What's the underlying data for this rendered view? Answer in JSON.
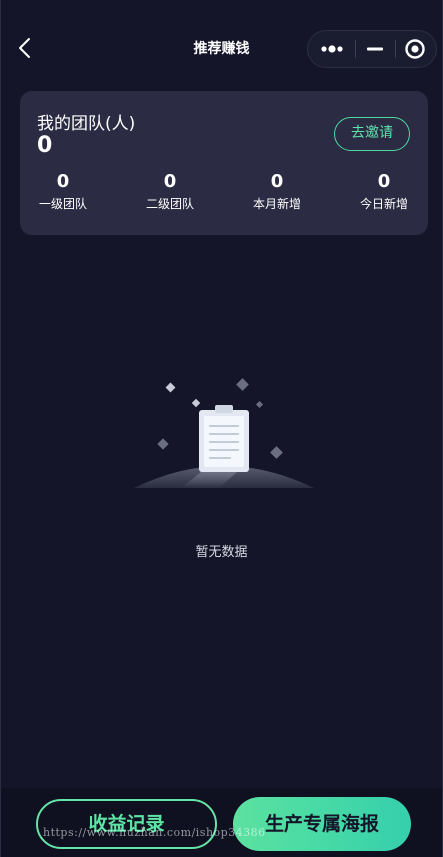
{
  "nav": {
    "title": "推荐赚钱",
    "back_icon": "chevron-left-icon",
    "capsule_icons": [
      "more-dots-icon",
      "minimize-icon",
      "close-target-icon"
    ]
  },
  "team": {
    "title": "我的团队(人)",
    "total": "0",
    "invite_label": "去邀请",
    "stats": [
      {
        "value": "0",
        "label": "一级团队"
      },
      {
        "value": "0",
        "label": "二级团队"
      },
      {
        "value": "0",
        "label": "本月新增"
      },
      {
        "value": "0",
        "label": "今日新增"
      }
    ]
  },
  "empty": {
    "icon": "empty-clipboard-icon",
    "text": "暂无数据"
  },
  "bottom": {
    "records_label": "收益记录",
    "poster_label": "生产专属海报"
  },
  "watermark": "https://www.huzhan.com/ishop34386",
  "colors": {
    "background": "#141528",
    "card": "#2b2c43",
    "accent": "#4fd7a0"
  }
}
